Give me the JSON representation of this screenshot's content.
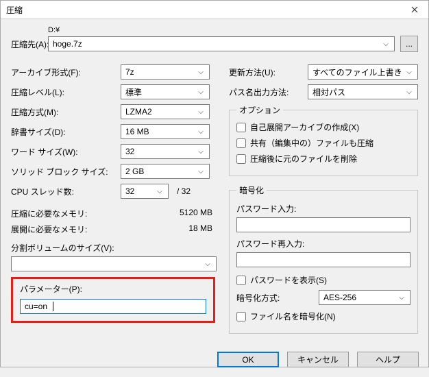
{
  "window": {
    "title": "圧縮"
  },
  "dest": {
    "label": "圧縮先(A):",
    "drive": "D:¥",
    "filename": "hoge.7z",
    "browse": "..."
  },
  "left": {
    "format_label": "アーカイブ形式(F):",
    "format_value": "7z",
    "level_label": "圧縮レベル(L):",
    "level_value": "標準",
    "method_label": "圧縮方式(M):",
    "method_value": "LZMA2",
    "dict_label": "辞書サイズ(D):",
    "dict_value": "16 MB",
    "word_label": "ワード サイズ(W):",
    "word_value": "32",
    "solid_label": "ソリッド ブロック サイズ:",
    "solid_value": "2 GB",
    "cpu_label": "CPU スレッド数:",
    "cpu_value": "32",
    "cpu_total": "/ 32",
    "mem_comp_label": "圧縮に必要なメモリ:",
    "mem_comp_value": "5120 MB",
    "mem_dec_label": "展開に必要なメモリ:",
    "mem_dec_value": "18 MB",
    "vol_label": "分割ボリュームのサイズ(V):",
    "param_label": "パラメーター(P):",
    "param_value": "cu=on"
  },
  "right": {
    "update_label": "更新方法(U):",
    "update_value": "すべてのファイル上書き",
    "pathmode_label": "パス名出力方法:",
    "pathmode_value": "相対パス",
    "options_legend": "オプション",
    "sfx_label": "自己展開アーカイブの作成(X)",
    "shared_label": "共有（編集中の）ファイルも圧縮",
    "delete_label": "圧縮後に元のファイルを削除",
    "enc_legend": "暗号化",
    "pwd_label": "パスワード入力:",
    "pwd2_label": "パスワード再入力:",
    "showpwd_label": "パスワードを表示(S)",
    "encmethod_label": "暗号化方式:",
    "encmethod_value": "AES-256",
    "encnames_label": "ファイル名を暗号化(N)"
  },
  "buttons": {
    "ok": "OK",
    "cancel": "キャンセル",
    "help": "ヘルプ"
  }
}
